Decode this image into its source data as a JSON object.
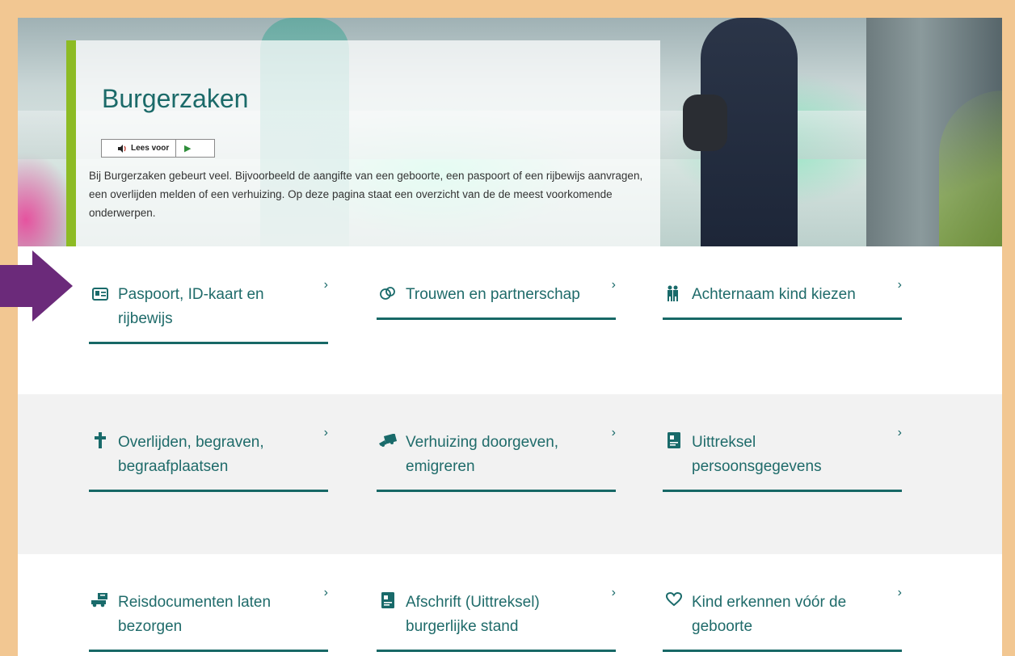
{
  "hero": {
    "title": "Burgerzaken",
    "read_aloud": {
      "label": "Lees voor",
      "speaker_icon": "speaker-icon",
      "play_icon": "play-icon"
    },
    "intro": "Bij Burgerzaken gebeurt veel. Bijvoorbeeld de aangifte van een geboorte, een paspoort of een rijbewijs aanvragen, een overlijden melden of een verhuizing. Op deze pagina staat een overzicht van de de meest voorkomende onderwerpen."
  },
  "tiles": [
    {
      "label": "Paspoort, ID-kaart en rijbewijs",
      "icon": "id-card-icon",
      "glyph": "▣"
    },
    {
      "label": "Trouwen en partnerschap",
      "icon": "rings-icon",
      "glyph": "⚭"
    },
    {
      "label": "Achternaam kind kiezen",
      "icon": "family-icon",
      "glyph": "👪"
    },
    {
      "label": "Overlijden, begraven, begraafplaatsen",
      "icon": "cross-icon",
      "glyph": "✝"
    },
    {
      "label": "Verhuizing doorgeven, emigreren",
      "icon": "moving-truck-icon",
      "glyph": "🚚"
    },
    {
      "label": "Uittreksel persoonsgegevens",
      "icon": "document-icon",
      "glyph": "▤"
    },
    {
      "label": "Reisdocumenten laten bezorgen",
      "icon": "delivery-icon",
      "glyph": "⛟"
    },
    {
      "label": "Afschrift (Uittreksel) burgerlijke stand",
      "icon": "document-icon",
      "glyph": "▤"
    },
    {
      "label": "Kind erkennen vóór de geboorte",
      "icon": "heart-icon",
      "glyph": "♡"
    }
  ],
  "chevron": "›",
  "colors": {
    "accent": "#196a6a",
    "hero_bar": "#8dbb24",
    "arrow": "#6b2a7a",
    "frame": "#f2c792"
  }
}
